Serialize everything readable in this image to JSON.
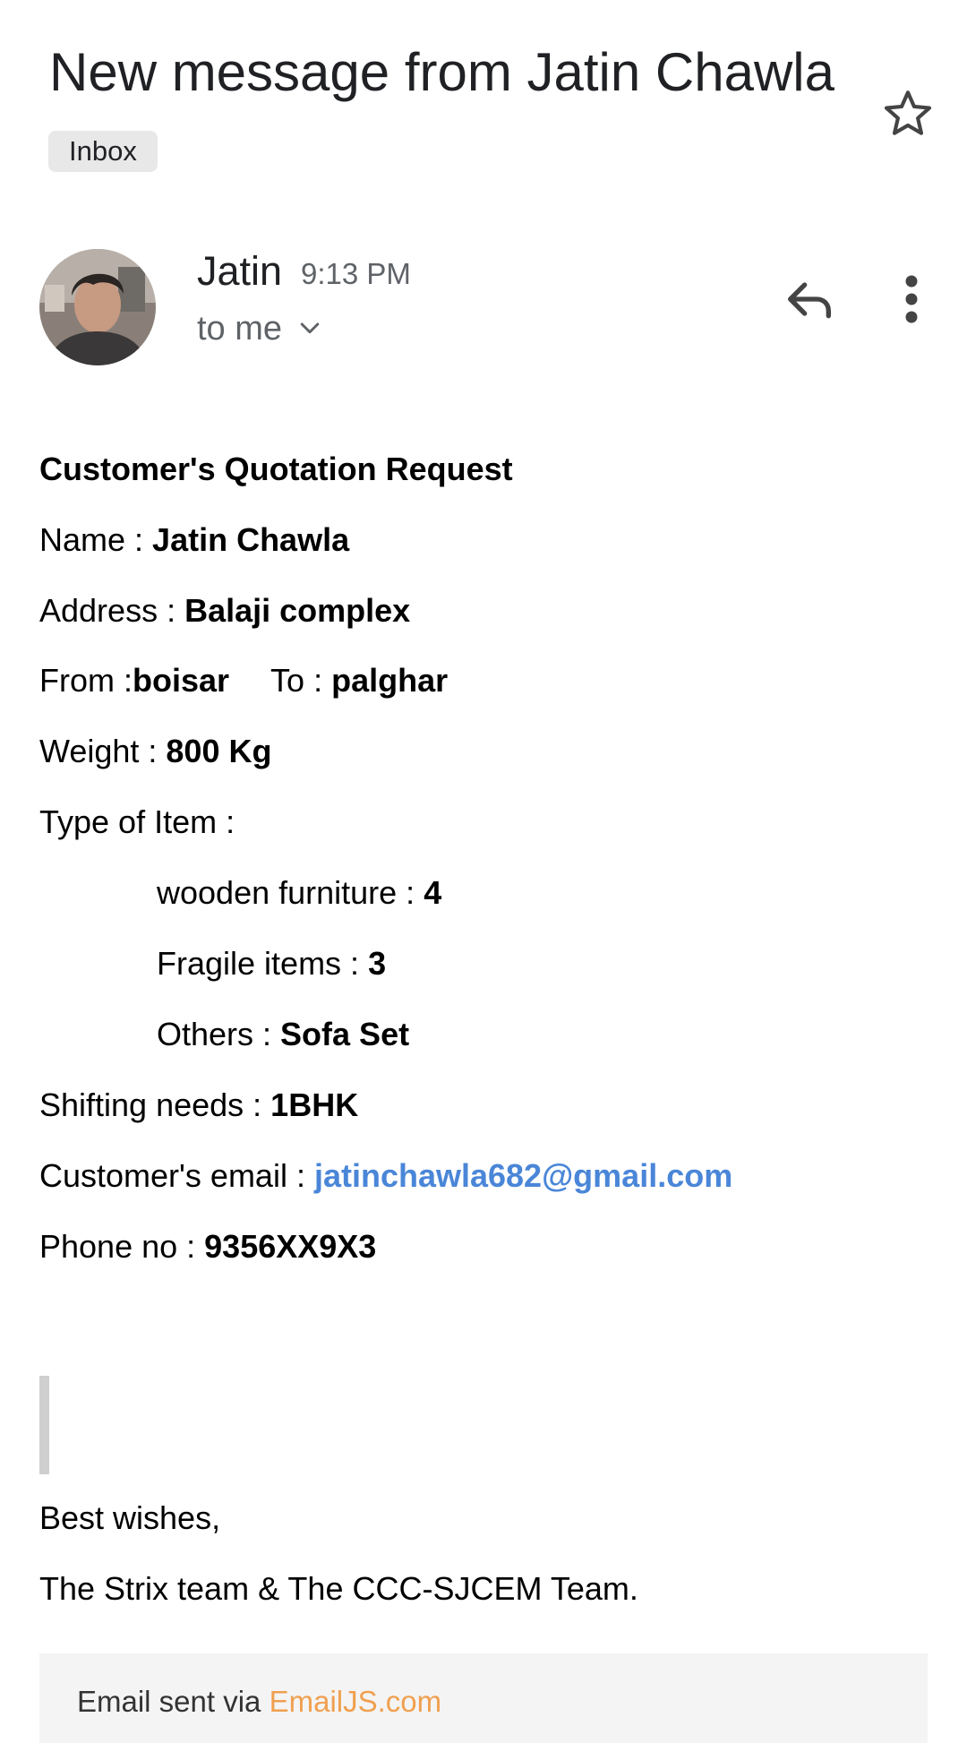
{
  "header": {
    "subject": "New message from Jatin Chawla",
    "label": "Inbox",
    "star_icon": "star-outline-icon"
  },
  "sender": {
    "name": "Jatin",
    "time": "9:13 PM",
    "recipient": "to me",
    "avatar_icon": "avatar-photo",
    "reply_icon": "reply-icon",
    "more_icon": "more-vertical-icon"
  },
  "body": {
    "heading": "Customer's Quotation Request",
    "name_label": "Name : ",
    "name_value": "Jatin Chawla",
    "address_label": "Address : ",
    "address_value": "Balaji complex",
    "from_label": "From :",
    "from_value": "boisar",
    "to_label": "To : ",
    "to_value": "palghar",
    "weight_label": "Weight : ",
    "weight_value": "800 Kg",
    "type_label": "Type of Item :",
    "items": [
      {
        "label": "wooden furniture : ",
        "value": "4"
      },
      {
        "label": "Fragile items : ",
        "value": "3"
      },
      {
        "label": "Others : ",
        "value": "Sofa Set"
      }
    ],
    "shifting_label": "Shifting needs : ",
    "shifting_value": "1BHK",
    "email_label": "Customer's email : ",
    "email_value": "jatinchawla682@gmail.com",
    "phone_label": "Phone no : ",
    "phone_value": "9356XX9X3",
    "closing": "Best wishes,",
    "team": "The Strix team & The CCC-SJCEM Team."
  },
  "footer": {
    "prefix": "Email sent via ",
    "link": "EmailJS.com"
  },
  "colors": {
    "link_blue": "#4a86d8",
    "footer_link_orange": "#f0a050",
    "chip_bg": "#e8e8e8",
    "footer_bg": "#f4f4f4"
  }
}
